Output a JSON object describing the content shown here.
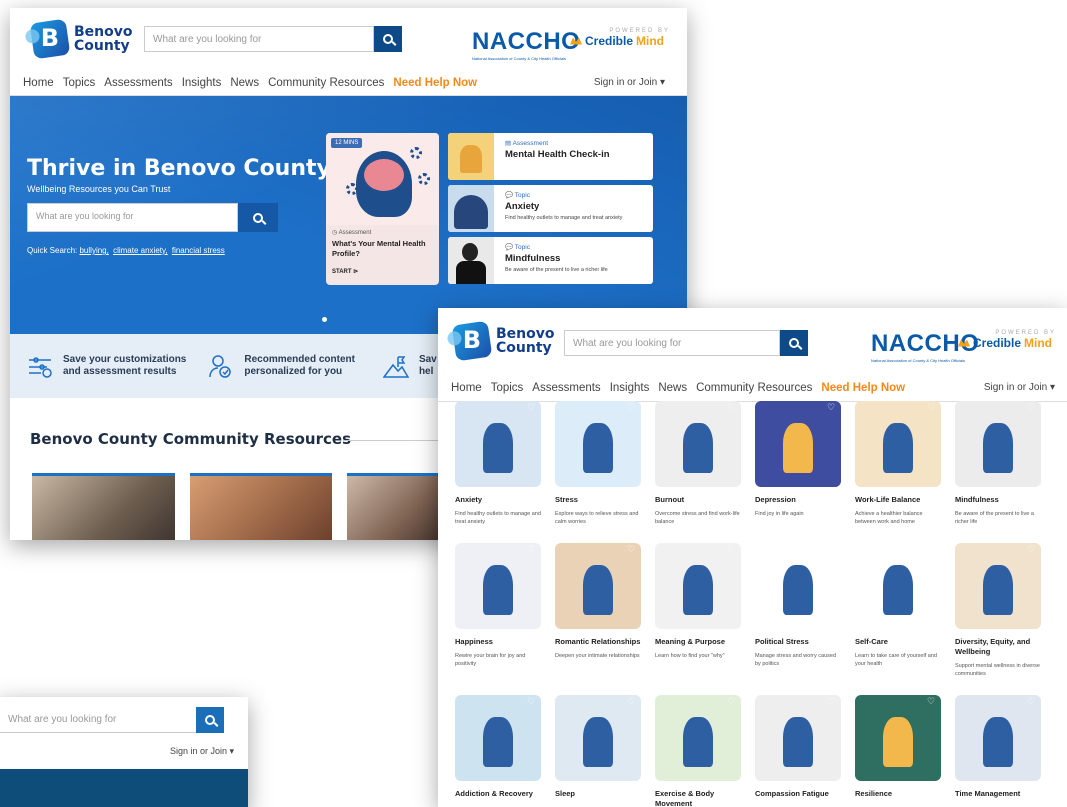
{
  "brand": {
    "logo_letter": "B",
    "name_line1": "Benovo",
    "name_line2": "County"
  },
  "search": {
    "placeholder": "What are you looking for"
  },
  "partners": {
    "naccho": "NACCHO",
    "naccho_sub": "National Association of County & City Health Officials",
    "powered_by": "POWERED BY",
    "credible_a": "Credible",
    "credible_b": "Mind"
  },
  "nav": {
    "items": [
      "Home",
      "Topics",
      "Assessments",
      "Insights",
      "News",
      "Community Resources"
    ],
    "help": "Need Help Now",
    "sign_in": "Sign in or Join ▾"
  },
  "hero": {
    "title": "Thrive in Benovo County",
    "subtitle": "Wellbeing Resources you Can Trust",
    "search_placeholder": "What are you looking for",
    "quick_label": "Quick Search:",
    "quick_links": [
      "bullying,",
      "climate anxiety,",
      "financial stress"
    ],
    "feature_card": {
      "tag": "12 MINS",
      "kind": "Assessment",
      "title": "What's Your Mental Health Profile?",
      "cta": "START"
    },
    "cards": [
      {
        "kind": "Assessment",
        "title": "Mental Health Check-in",
        "desc": ""
      },
      {
        "kind": "Topic",
        "title": "Anxiety",
        "desc": "Find healthy outlets to manage and treat anxiety"
      },
      {
        "kind": "Topic",
        "title": "Mindfulness",
        "desc": "Be aware of the present to live a richer life"
      }
    ]
  },
  "features": [
    {
      "text1": "Save your customizations",
      "text2": "and assessment results"
    },
    {
      "text1": "Recommended content",
      "text2": "personalized for you"
    },
    {
      "text1": "Sav",
      "text2": "hel"
    }
  ],
  "resources": {
    "title": "Benovo County Community Resources"
  },
  "topics": [
    {
      "name": "Anxiety",
      "desc": "Find healthy outlets to manage and treat anxiety",
      "bg": "#d8e6f3"
    },
    {
      "name": "Stress",
      "desc": "Explore ways to relieve stress and calm worries",
      "bg": "#dcecf8"
    },
    {
      "name": "Burnout",
      "desc": "Overcome stress and find work-life balance",
      "bg": "#eeeeee"
    },
    {
      "name": "Depression",
      "desc": "Find joy in life again",
      "bg": "#3f4da0"
    },
    {
      "name": "Work-Life Balance",
      "desc": "Achieve a healthier balance between work and home",
      "bg": "#f4e3c4"
    },
    {
      "name": "Mindfulness",
      "desc": "Be aware of the present to live a richer life",
      "bg": "#ececec"
    },
    {
      "name": "Happiness",
      "desc": "Rewire your brain for joy and positivity",
      "bg": "#eef0f5"
    },
    {
      "name": "Romantic Relationships",
      "desc": "Deepen your intimate relationships",
      "bg": "#e9d2b6"
    },
    {
      "name": "Meaning & Purpose",
      "desc": "Learn how to find your \"why\"",
      "bg": "#f1f1f1"
    },
    {
      "name": "Political Stress",
      "desc": "Manage stress and worry caused by politics",
      "bg": "#ffffff"
    },
    {
      "name": "Self-Care",
      "desc": "Learn to take care of yourself and your health",
      "bg": "#ffffff"
    },
    {
      "name": "Diversity, Equity, and Wellbeing",
      "desc": "Support mental wellness in diverse communities",
      "bg": "#f0e2cc"
    },
    {
      "name": "Addiction & Recovery",
      "desc": "",
      "bg": "#cde3f0"
    },
    {
      "name": "Sleep",
      "desc": "",
      "bg": "#dfe9f2"
    },
    {
      "name": "Exercise & Body Movement",
      "desc": "",
      "bg": "#e1efd9"
    },
    {
      "name": "Compassion Fatigue",
      "desc": "",
      "bg": "#eeeeee"
    },
    {
      "name": "Resilience",
      "desc": "",
      "bg": "#2f6f62"
    },
    {
      "name": "Time Management",
      "desc": "",
      "bg": "#dfe6f0"
    }
  ],
  "icons": {
    "search": "search-icon",
    "heart": "heart-icon",
    "sliders": "sliders-icon",
    "person": "person-check-icon",
    "mountain": "mountain-flag-icon"
  },
  "colors": {
    "primary": "#1d70c8",
    "navy": "#0f4a88",
    "help": "#f28a1a"
  }
}
